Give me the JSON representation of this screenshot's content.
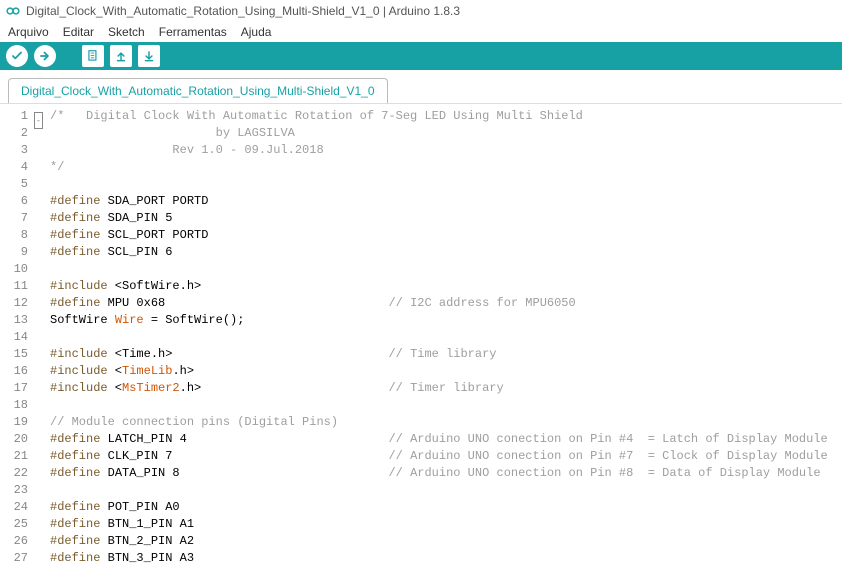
{
  "title": "Digital_Clock_With_Automatic_Rotation_Using_Multi-Shield_V1_0 | Arduino 1.8.3",
  "menu": {
    "arquivo": "Arquivo",
    "editar": "Editar",
    "sketch": "Sketch",
    "ferramentas": "Ferramentas",
    "ajuda": "Ajuda"
  },
  "tab": "Digital_Clock_With_Automatic_Rotation_Using_Multi-Shield_V1_0",
  "code": {
    "l1": "/*   Digital Clock With Automatic Rotation of 7-Seg LED Using Multi Shield",
    "l2": "                       by LAGSILVA",
    "l3": "                 Rev 1.0 - 09.Jul.2018",
    "l4": "*/",
    "l5": "",
    "l6a": "#define",
    "l6b": " SDA_PORT PORTD",
    "l7a": "#define",
    "l7b": " SDA_PIN 5",
    "l8a": "#define",
    "l8b": " SCL_PORT PORTD",
    "l9a": "#define",
    "l9b": " SCL_PIN 6",
    "l10": "",
    "l11a": "#include",
    "l11b": " <SoftWire.h>",
    "l12a": "#define",
    "l12b": " MPU 0x68                               ",
    "l12c": "// I2C address for MPU6050",
    "l13a": "SoftWire ",
    "l13b": "Wire",
    "l13c": " = SoftWire();",
    "l14": "",
    "l15a": "#include",
    "l15b": " <Time.h>                              ",
    "l15c": "// Time library",
    "l16a": "#include",
    "l16b": " <",
    "l16c": "TimeLib",
    "l16d": ".h>",
    "l17a": "#include",
    "l17b": " <",
    "l17c": "MsTimer2",
    "l17d": ".h>                          ",
    "l17e": "// Timer library",
    "l18": "",
    "l19": "// Module connection pins (Digital Pins)",
    "l20a": "#define",
    "l20b": " LATCH_PIN 4                            ",
    "l20c": "// Arduino UNO conection on Pin #4  = Latch of Display Module",
    "l21a": "#define",
    "l21b": " CLK_PIN 7                              ",
    "l21c": "// Arduino UNO conection on Pin #7  = Clock of Display Module",
    "l22a": "#define",
    "l22b": " DATA_PIN 8                             ",
    "l22c": "// Arduino UNO conection on Pin #8  = Data of Display Module",
    "l23": "",
    "l24a": "#define",
    "l24b": " POT_PIN A0",
    "l25a": "#define",
    "l25b": " BTN_1_PIN A1",
    "l26a": "#define",
    "l26b": " BTN_2_PIN A2",
    "l27a": "#define",
    "l27b": " BTN_3_PIN A3"
  }
}
